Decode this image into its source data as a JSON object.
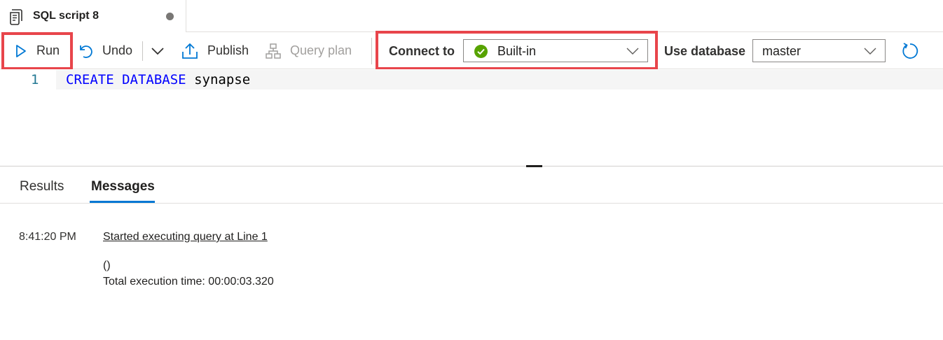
{
  "tab": {
    "title": "SQL script 8",
    "icon": "script-icon",
    "unsaved_indicator": "unsaved-dot"
  },
  "toolbar": {
    "run_label": "Run",
    "undo_label": "Undo",
    "publish_label": "Publish",
    "query_plan_label": "Query plan",
    "connect_to_label": "Connect to",
    "connect_to_value": "Built-in",
    "connect_status": "connected",
    "use_database_label": "Use database",
    "use_database_value": "master"
  },
  "editor": {
    "lines": [
      {
        "number": "1",
        "tokens": [
          "CREATE",
          "DATABASE",
          "synapse"
        ]
      }
    ]
  },
  "results": {
    "tabs": [
      {
        "label": "Results",
        "active": false
      },
      {
        "label": "Messages",
        "active": true
      }
    ],
    "messages": [
      {
        "time": "8:41:20 PM",
        "link": "Started executing query at Line 1",
        "lines": [
          "()",
          "Total execution time: 00:00:03.320"
        ]
      }
    ]
  },
  "colors": {
    "accent": "#0078d4",
    "highlight_box": "#e8454b",
    "status_ok": "#57a300",
    "keyword": "#0000ff",
    "line_number": "#237893"
  }
}
